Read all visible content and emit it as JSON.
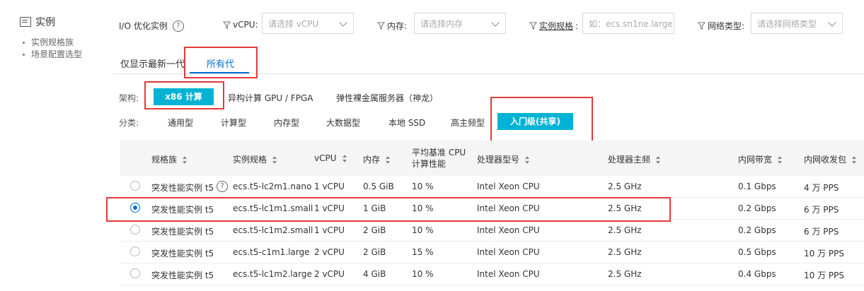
{
  "sidebar": {
    "title": "实例",
    "title_icon": "instance-icon",
    "items": [
      {
        "label": "实例规格族"
      },
      {
        "label": "场景配置选型"
      }
    ]
  },
  "filters": {
    "io_label": "I/O 优化实例",
    "io_help_icon": "question-circle-icon",
    "vcpu_label": "vCPU:",
    "vcpu_placeholder": "请选择 vCPU",
    "memory_label": "内存:",
    "memory_placeholder": "请选择内存",
    "spec_label": "实例规格",
    "spec_colon": ":",
    "spec_placeholder": "如：ecs.sn1ne.large",
    "network_label": "网络类型:",
    "network_placeholder": "请选择网络类型"
  },
  "generation_tabs": [
    {
      "label": "仅显示最新一代",
      "active": false
    },
    {
      "label": "所有代",
      "active": true
    }
  ],
  "architecture": {
    "label": "架构:",
    "options": [
      {
        "label": "x86 计算",
        "active": true
      },
      {
        "label": "异构计算 GPU / FPGA",
        "active": false
      },
      {
        "label": "弹性裸金属服务器（神龙）",
        "active": false
      }
    ]
  },
  "category": {
    "label": "分类:",
    "options": [
      {
        "label": "通用型",
        "active": false
      },
      {
        "label": "计算型",
        "active": false
      },
      {
        "label": "内存型",
        "active": false
      },
      {
        "label": "大数据型",
        "active": false
      },
      {
        "label": "本地 SSD",
        "active": false
      },
      {
        "label": "高主频型",
        "active": false
      },
      {
        "label": "入门级(共享)",
        "active": true
      }
    ]
  },
  "table": {
    "headers": {
      "family": "规格族",
      "spec": "实例规格",
      "vcpu": "vCPU",
      "memory": "内存",
      "baseline_line1": "平均基准 CPU",
      "baseline_line2": "计算性能",
      "cpu_model": "处理器型号",
      "cpu_freq": "处理器主频",
      "bandwidth": "内网带宽",
      "pps": "内网收发包"
    },
    "rows": [
      {
        "selected": false,
        "family": "突发性能实例 t5",
        "has_help": true,
        "spec": "ecs.t5-lc2m1.nano",
        "vcpu": "1 vCPU",
        "memory": "0.5 GiB",
        "baseline": "10 %",
        "cpu_model": "Intel Xeon CPU",
        "cpu_freq": "2.5 GHz",
        "bandwidth": "0.1 Gbps",
        "pps": "4 万 PPS"
      },
      {
        "selected": true,
        "family": "突发性能实例 t5",
        "has_help": false,
        "spec": "ecs.t5-lc1m1.small",
        "vcpu": "1 vCPU",
        "memory": "1 GiB",
        "baseline": "10 %",
        "cpu_model": "Intel Xeon CPU",
        "cpu_freq": "2.5 GHz",
        "bandwidth": "0.2 Gbps",
        "pps": "6 万 PPS"
      },
      {
        "selected": false,
        "family": "突发性能实例 t5",
        "has_help": false,
        "spec": "ecs.t5-lc1m2.small",
        "vcpu": "1 vCPU",
        "memory": "2 GiB",
        "baseline": "10 %",
        "cpu_model": "Intel Xeon CPU",
        "cpu_freq": "2.5 GHz",
        "bandwidth": "0.2 Gbps",
        "pps": "6 万 PPS"
      },
      {
        "selected": false,
        "family": "突发性能实例 t5",
        "has_help": false,
        "spec": "ecs.t5-c1m1.large",
        "vcpu": "2 vCPU",
        "memory": "2 GiB",
        "baseline": "15 %",
        "cpu_model": "Intel Xeon CPU",
        "cpu_freq": "2.5 GHz",
        "bandwidth": "0.5 Gbps",
        "pps": "10 万 PPS"
      },
      {
        "selected": false,
        "family": "突发性能实例 t5",
        "has_help": false,
        "spec": "ecs.t5-lc1m2.large",
        "vcpu": "2 vCPU",
        "memory": "4 GiB",
        "baseline": "10 %",
        "cpu_model": "Intel Xeon CPU",
        "cpu_freq": "2.5 GHz",
        "bandwidth": "0.4 Gbps",
        "pps": "10 万 PPS"
      }
    ]
  },
  "colors": {
    "accent": "#00b3d4",
    "link": "#0070cc",
    "highlight_border": "#e4393c"
  }
}
